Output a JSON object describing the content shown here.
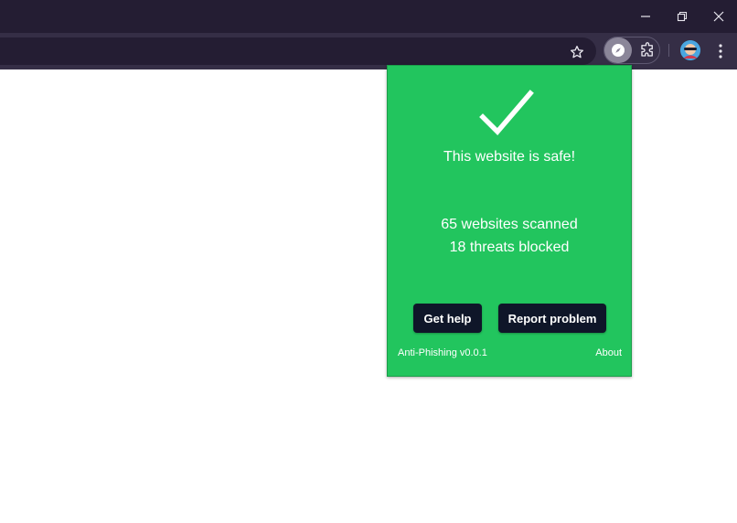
{
  "window": {
    "controls": [
      "minimize-icon",
      "restore-icon",
      "close-icon"
    ]
  },
  "toolbar": {
    "icons": [
      "star-icon",
      "extension-icon",
      "puzzle-icon",
      "profile-avatar",
      "more-vert-icon"
    ]
  },
  "popup": {
    "status_text": "This website is safe!",
    "websites_scanned": "65 websites scanned",
    "threats_blocked": "18 threats blocked",
    "get_help_label": "Get help",
    "report_problem_label": "Report problem",
    "version": "Anti-Phishing v0.0.1",
    "about_label": "About",
    "background_color": "#22c55e",
    "button_color": "#0f1629"
  }
}
